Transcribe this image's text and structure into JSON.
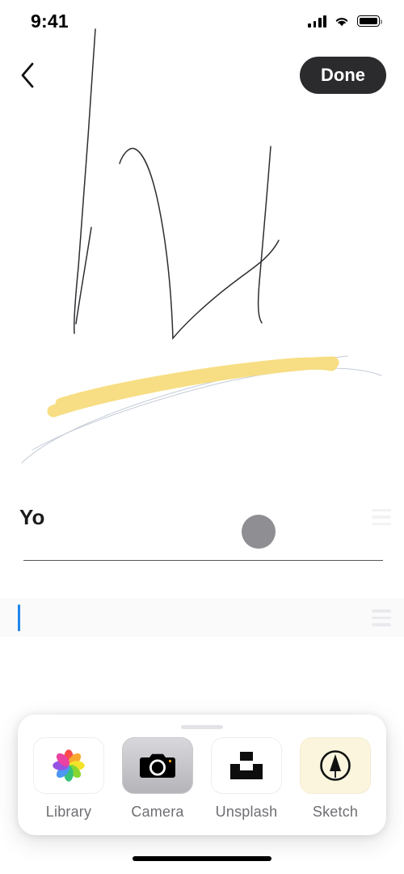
{
  "status_bar": {
    "time": "9:41",
    "signal_icon": "cellular-bars-icon",
    "wifi_icon": "wifi-icon",
    "battery_icon": "battery-full-icon"
  },
  "nav": {
    "back_icon": "chevron-left-icon",
    "done_label": "Done"
  },
  "canvas": {
    "name": "drawing-canvas",
    "ink_color": "#2e2e33",
    "highlighter_color": "#f7dd7e",
    "light_pen_color": "#b9c2d0"
  },
  "note": {
    "title": "Yo",
    "avatar_color": "#8e8e93",
    "divider_color": "#3a3a3c",
    "caret_color": "#1f86ea",
    "edit_row_value": "",
    "edit_row_placeholder": ""
  },
  "sheet": {
    "grab_handle": "sheet-grab-handle",
    "items": [
      {
        "label": "Library",
        "icon": "photos-library-icon"
      },
      {
        "label": "Camera",
        "icon": "camera-icon"
      },
      {
        "label": "Unsplash",
        "icon": "unsplash-logo-icon"
      },
      {
        "label": "Sketch",
        "icon": "sketch-pen-icon"
      },
      {
        "label": "",
        "icon": "yellow-tile-icon"
      }
    ]
  },
  "home_indicator": "home-indicator"
}
